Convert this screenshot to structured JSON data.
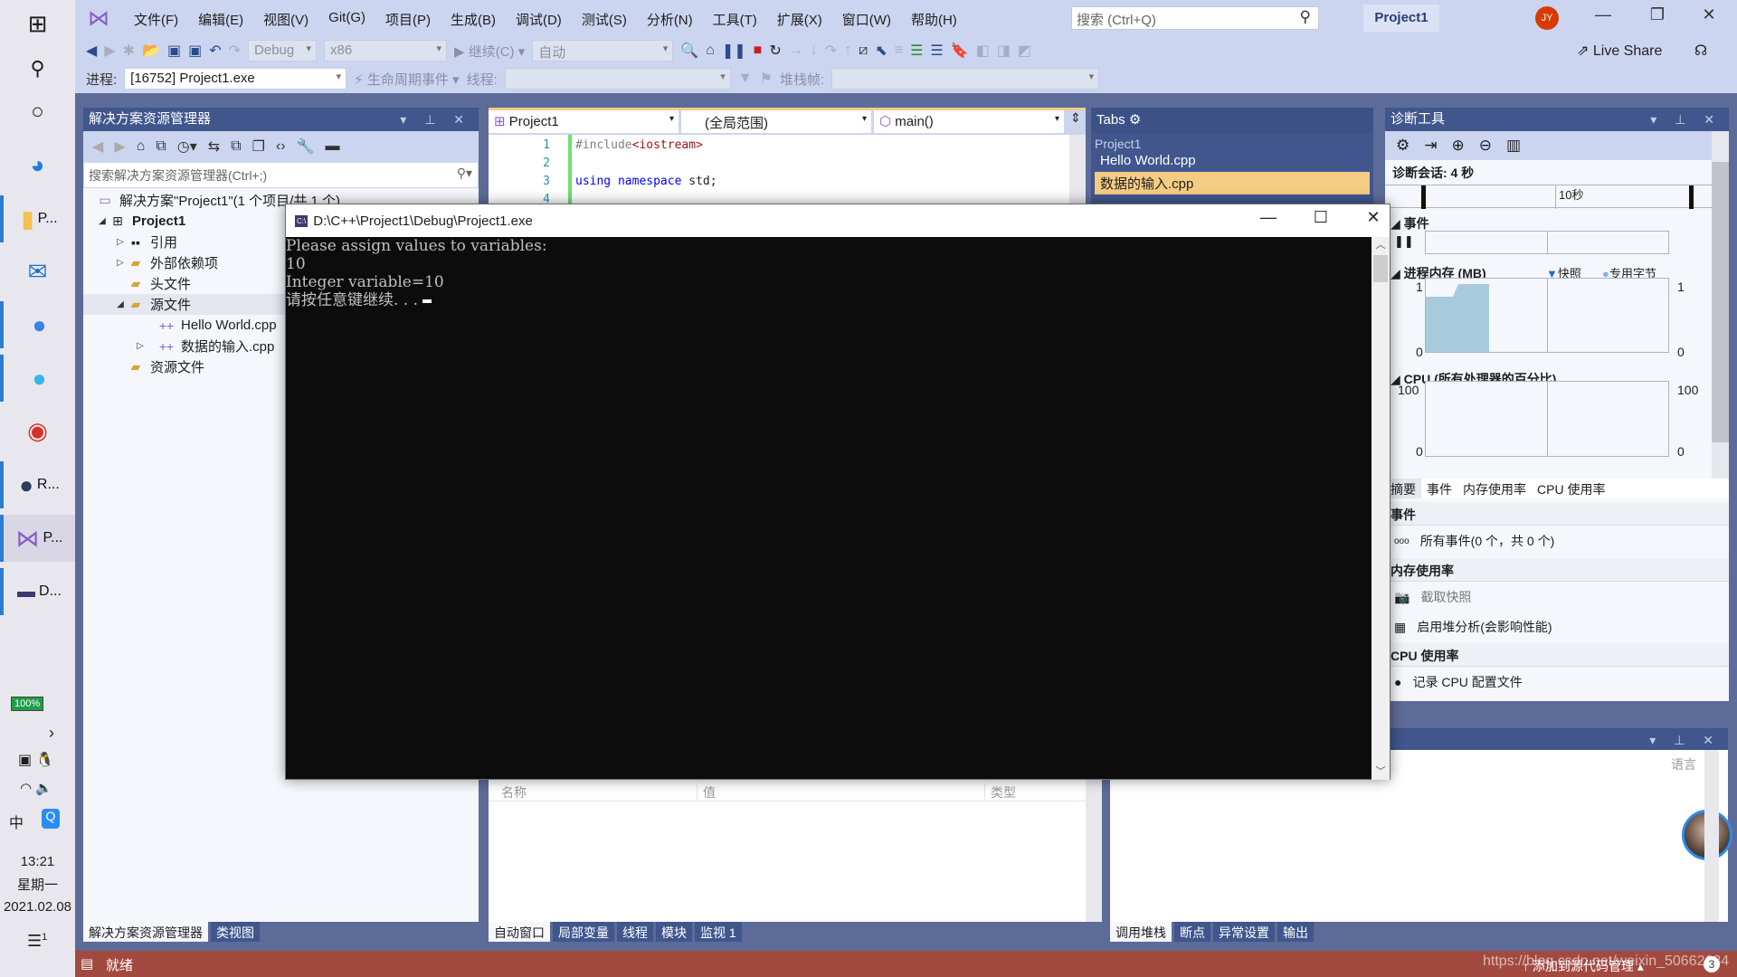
{
  "taskbar": {
    "items": [
      {
        "icon": "windows-icon"
      },
      {
        "icon": "search-icon"
      },
      {
        "icon": "cortana-icon"
      },
      {
        "icon": "edge-icon"
      },
      {
        "icon": "folder-icon",
        "label": "P..."
      },
      {
        "icon": "mail-icon"
      },
      {
        "icon": "l-app-icon"
      },
      {
        "icon": "e-app-icon"
      },
      {
        "icon": "chrome-icon"
      },
      {
        "icon": "app-icon",
        "label": "R..."
      },
      {
        "icon": "visual-studio-icon",
        "label": "P..."
      },
      {
        "icon": "console-icon",
        "label": "D..."
      }
    ],
    "battery": "100%",
    "ime": "中",
    "time": "13:21",
    "weekday": "星期一",
    "date": "2021.02.08",
    "notifications": "1"
  },
  "menu": [
    "文件(F)",
    "编辑(E)",
    "视图(V)",
    "Git(G)",
    "项目(P)",
    "生成(B)",
    "调试(D)",
    "测试(S)",
    "分析(N)",
    "工具(T)",
    "扩展(X)",
    "窗口(W)",
    "帮助(H)"
  ],
  "search_placeholder": "搜索 (Ctrl+Q)",
  "project_badge": "Project1",
  "user_initials": "JY",
  "toolbar": {
    "config": "Debug",
    "platform": "x86",
    "continue": "继续(C)",
    "auto": "自动",
    "live_share": "Live Share",
    "process_label": "进程:",
    "process": "[16752] Project1.exe",
    "lifecycle": "生命周期事件",
    "thread_label": "线程:",
    "stack_label": "堆栈帧:"
  },
  "solution_explorer": {
    "title": "解决方案资源管理器",
    "search_placeholder": "搜索解决方案资源管理器(Ctrl+;)",
    "tree": [
      {
        "label": "解决方案\"Project1\"(1 个项目/共 1 个)"
      },
      {
        "label": "Project1"
      },
      {
        "label": "引用"
      },
      {
        "label": "外部依赖项"
      },
      {
        "label": "头文件"
      },
      {
        "label": "源文件"
      },
      {
        "label": "Hello World.cpp"
      },
      {
        "label": "数据的输入.cpp"
      },
      {
        "label": "资源文件"
      }
    ],
    "tabs": [
      "解决方案资源管理器",
      "类视图"
    ]
  },
  "editor": {
    "nav": [
      "Project1",
      "(全局范围)",
      "main()"
    ],
    "lines": [
      {
        "n": "1",
        "pp": "#include",
        "str": "<iostream>"
      },
      {
        "n": "2"
      },
      {
        "n": "3",
        "kw1": "using",
        "kw2": "namespace",
        "rest": "std;"
      },
      {
        "n": "4"
      }
    ]
  },
  "tabs_panel": {
    "title": "Tabs",
    "group": "Project1",
    "files": [
      "Hello World.cpp",
      "数据的输入.cpp"
    ],
    "selected": "数据的输入.cpp"
  },
  "diagnostics": {
    "title": "诊断工具",
    "session": "诊断会话: 4 秒",
    "ruler_label": "10秒",
    "events_label": "事件",
    "memory_label": "进程内存 (MB)",
    "snapshot_legend": "快照",
    "private_bytes_legend": "专用字节",
    "mem_max": "1",
    "mem_min": "0",
    "cpu_label": "CPU (所有处理器的百分比)",
    "cpu_max": "100",
    "cpu_min": "0",
    "tabs": [
      "摘要",
      "事件",
      "内存使用率",
      "CPU 使用率"
    ],
    "sections": {
      "events": "事件",
      "all_events": "所有事件(0 个，共 0 个)",
      "memory": "内存使用率",
      "take_snapshot": "截取快照",
      "heap_profiling": "启用堆分析(会影响性能)",
      "cpu": "CPU 使用率",
      "record_cpu": "记录 CPU 配置文件"
    },
    "memory_color": "#a8cadc"
  },
  "console": {
    "title": "D:\\C++\\Project1\\Debug\\Project1.exe",
    "lines": [
      "Please assign values to variables:",
      "10",
      "Integer variable=10",
      "请按任意键继续. . . "
    ]
  },
  "autos": {
    "columns": [
      "名称",
      "值",
      "类型"
    ],
    "tabs": [
      "自动窗口",
      "局部变量",
      "线程",
      "模块",
      "监视 1"
    ]
  },
  "callstack": {
    "column": "语言",
    "tabs": [
      "调用堆栈",
      "断点",
      "异常设置",
      "输出"
    ]
  },
  "status": {
    "text": "就绪",
    "source_control": "添加到源代码管理",
    "watermark": "https://blog.csdn.net/weixin_50662634",
    "badge": "3"
  }
}
